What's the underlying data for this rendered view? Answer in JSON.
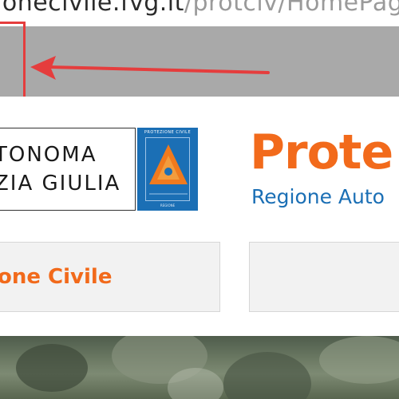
{
  "browser": {
    "url_host": "ionecivile.fvg.it",
    "url_path": "/protciv/HomePag"
  },
  "annotation": {
    "box_color": "#e53d3d",
    "arrow_color": "#e53d3d"
  },
  "header": {
    "region_logo_lines": [
      "TONOMA",
      "ZIA GIULIA"
    ],
    "emblem_top_text": "PROTEZIONE CIVILE",
    "emblem_bottom_text": "REGIONE",
    "emblem_color": "#1b6fb5",
    "wordmark": "Prote",
    "wordmark_color": "#f26a1b",
    "subline": "Regione Auto",
    "subline_color": "#1b6fb5"
  },
  "nav": {
    "tabs": [
      {
        "label": "one Civile"
      },
      {
        "label": ""
      }
    ]
  },
  "icons": [
    "arrow-left-icon",
    "civil-protection-emblem-icon"
  ]
}
